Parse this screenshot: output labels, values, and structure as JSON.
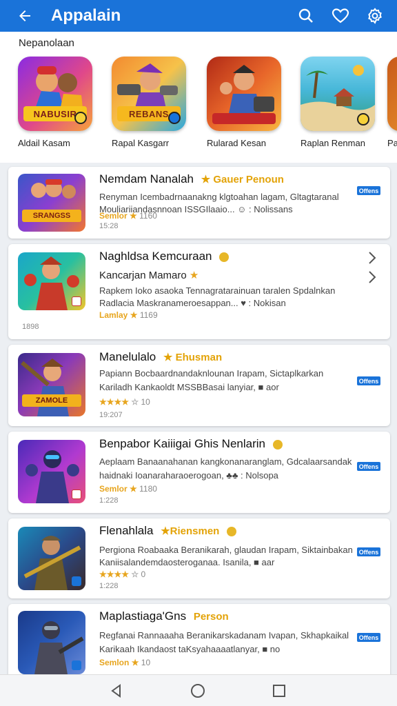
{
  "app": {
    "title": "Appalain",
    "accent": "#1a73d9"
  },
  "header": {
    "icons": [
      "back-arrow-icon",
      "search-icon",
      "heart-icon",
      "settings-gear-icon"
    ]
  },
  "featured": {
    "label": "Nepanolaan",
    "items": [
      {
        "name": "Aldail Kasam",
        "banner": "NABUSIR"
      },
      {
        "name": "Rapal Kasgarr",
        "banner": "REBANS"
      },
      {
        "name": "Rularad Kesan",
        "banner": ""
      },
      {
        "name": "Raplan Renman",
        "banner": ""
      },
      {
        "name": "Pa",
        "banner": ""
      }
    ]
  },
  "list": [
    {
      "title": "Nemdam Nanalah",
      "tag": "Gauer Penoun",
      "icon_banner": "SRANGSS",
      "line1": "Renyman Icembadrnaanakng klgtoahan lagam, Gltagtaranal",
      "line2": "Mouliariiandasnnoan ISSGIlaaio... ☺ : Nolissans",
      "rating": "Semlor",
      "stars": "★",
      "count": "1160",
      "date": "15:28"
    },
    {
      "title": "Naghldsa Kemcuraan",
      "tag": "",
      "subtitle": "Kancarjan Mamaro",
      "icon_banner": "",
      "line1": "Rapkem Ioko asaoka Tennagratarainuan taralen Spdalnkan",
      "line2": "Radlacia Maskranameroesappan... ♥ : Nokisan",
      "rating": "Lamlay",
      "stars": "★",
      "count": "1169",
      "date": "1898"
    },
    {
      "title": "Manelulalo",
      "tag": "Ehusman",
      "icon_banner": "ZAMOLE",
      "line1": "Papiann Bocbaardnandaknlounan Irapam, Sictaplkarkan",
      "line2": "Kariladh Kankaoldt MSSBBasai lanyiar, ■ aor",
      "rating": "",
      "stars": "★★★★",
      "count": "10",
      "date": "19:207"
    },
    {
      "title": "Benpabor Kaiiigai Ghis Nenlarin",
      "tag": "",
      "icon_banner": "",
      "line1": "Aeplaam Banaanahanan kangkonanaranglam, Gdcalaarsandak",
      "line2": "haidnaki Ioanaraharaoerogoan, ♣♣ : Nolsopa",
      "rating": "Semlor",
      "stars": "★",
      "count": "1180",
      "date": "1:228"
    },
    {
      "title": "Flenahlala",
      "tag": "Riensmen",
      "icon_banner": "",
      "line1": "Pergiona Roabaaka Beranikarah, glaudan Irapam, Siktainbakan",
      "line2": "Kaniisalandemdaosteroganaa. Isanila, ■ aar",
      "rating": "",
      "stars": "★★★★",
      "count": "0",
      "date": "1:228"
    },
    {
      "title": "Maplastiaga'Gns",
      "tag": "Person",
      "icon_banner": "",
      "line1": "Regfanai Rannaaaha Beranikarskadanam Ivapan, Skhapkaikal",
      "line2": "Karikaah Ikandaost taKsyahaaaatlanyar, ■ no",
      "rating": "Semlon",
      "stars": "★",
      "count": "10",
      "date": ""
    }
  ],
  "offer_label": "Offens",
  "nav": {
    "icons": [
      "back-triangle-icon",
      "home-circle-icon",
      "recents-square-icon"
    ]
  }
}
